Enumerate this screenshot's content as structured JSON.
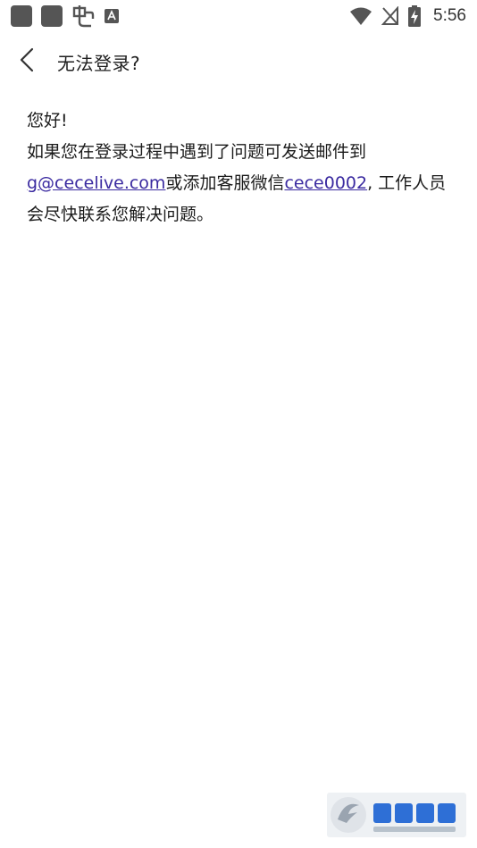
{
  "status_bar": {
    "time": "5:56",
    "icons": [
      "notification-square",
      "notification-square",
      "app-notification-icon",
      "keyboard-notification-icon",
      "wifi-icon",
      "no-signal-icon",
      "battery-charging-icon"
    ]
  },
  "app_bar": {
    "back_icon": "chevron-left-icon",
    "title": "无法登录?"
  },
  "message": {
    "greeting": "您好!",
    "line1_prefix": "如果您在登录过程中遇到了问题可发送邮件到",
    "email": "g@cecelive.com",
    "line2_mid": "或添加客服微信",
    "wechat": "cece0002",
    "line2_suffix": ", 工作人员会尽快联系您解决问题。"
  },
  "colors": {
    "link": "#3a2aa0",
    "text": "#1b1b1b",
    "background": "#ffffff"
  }
}
